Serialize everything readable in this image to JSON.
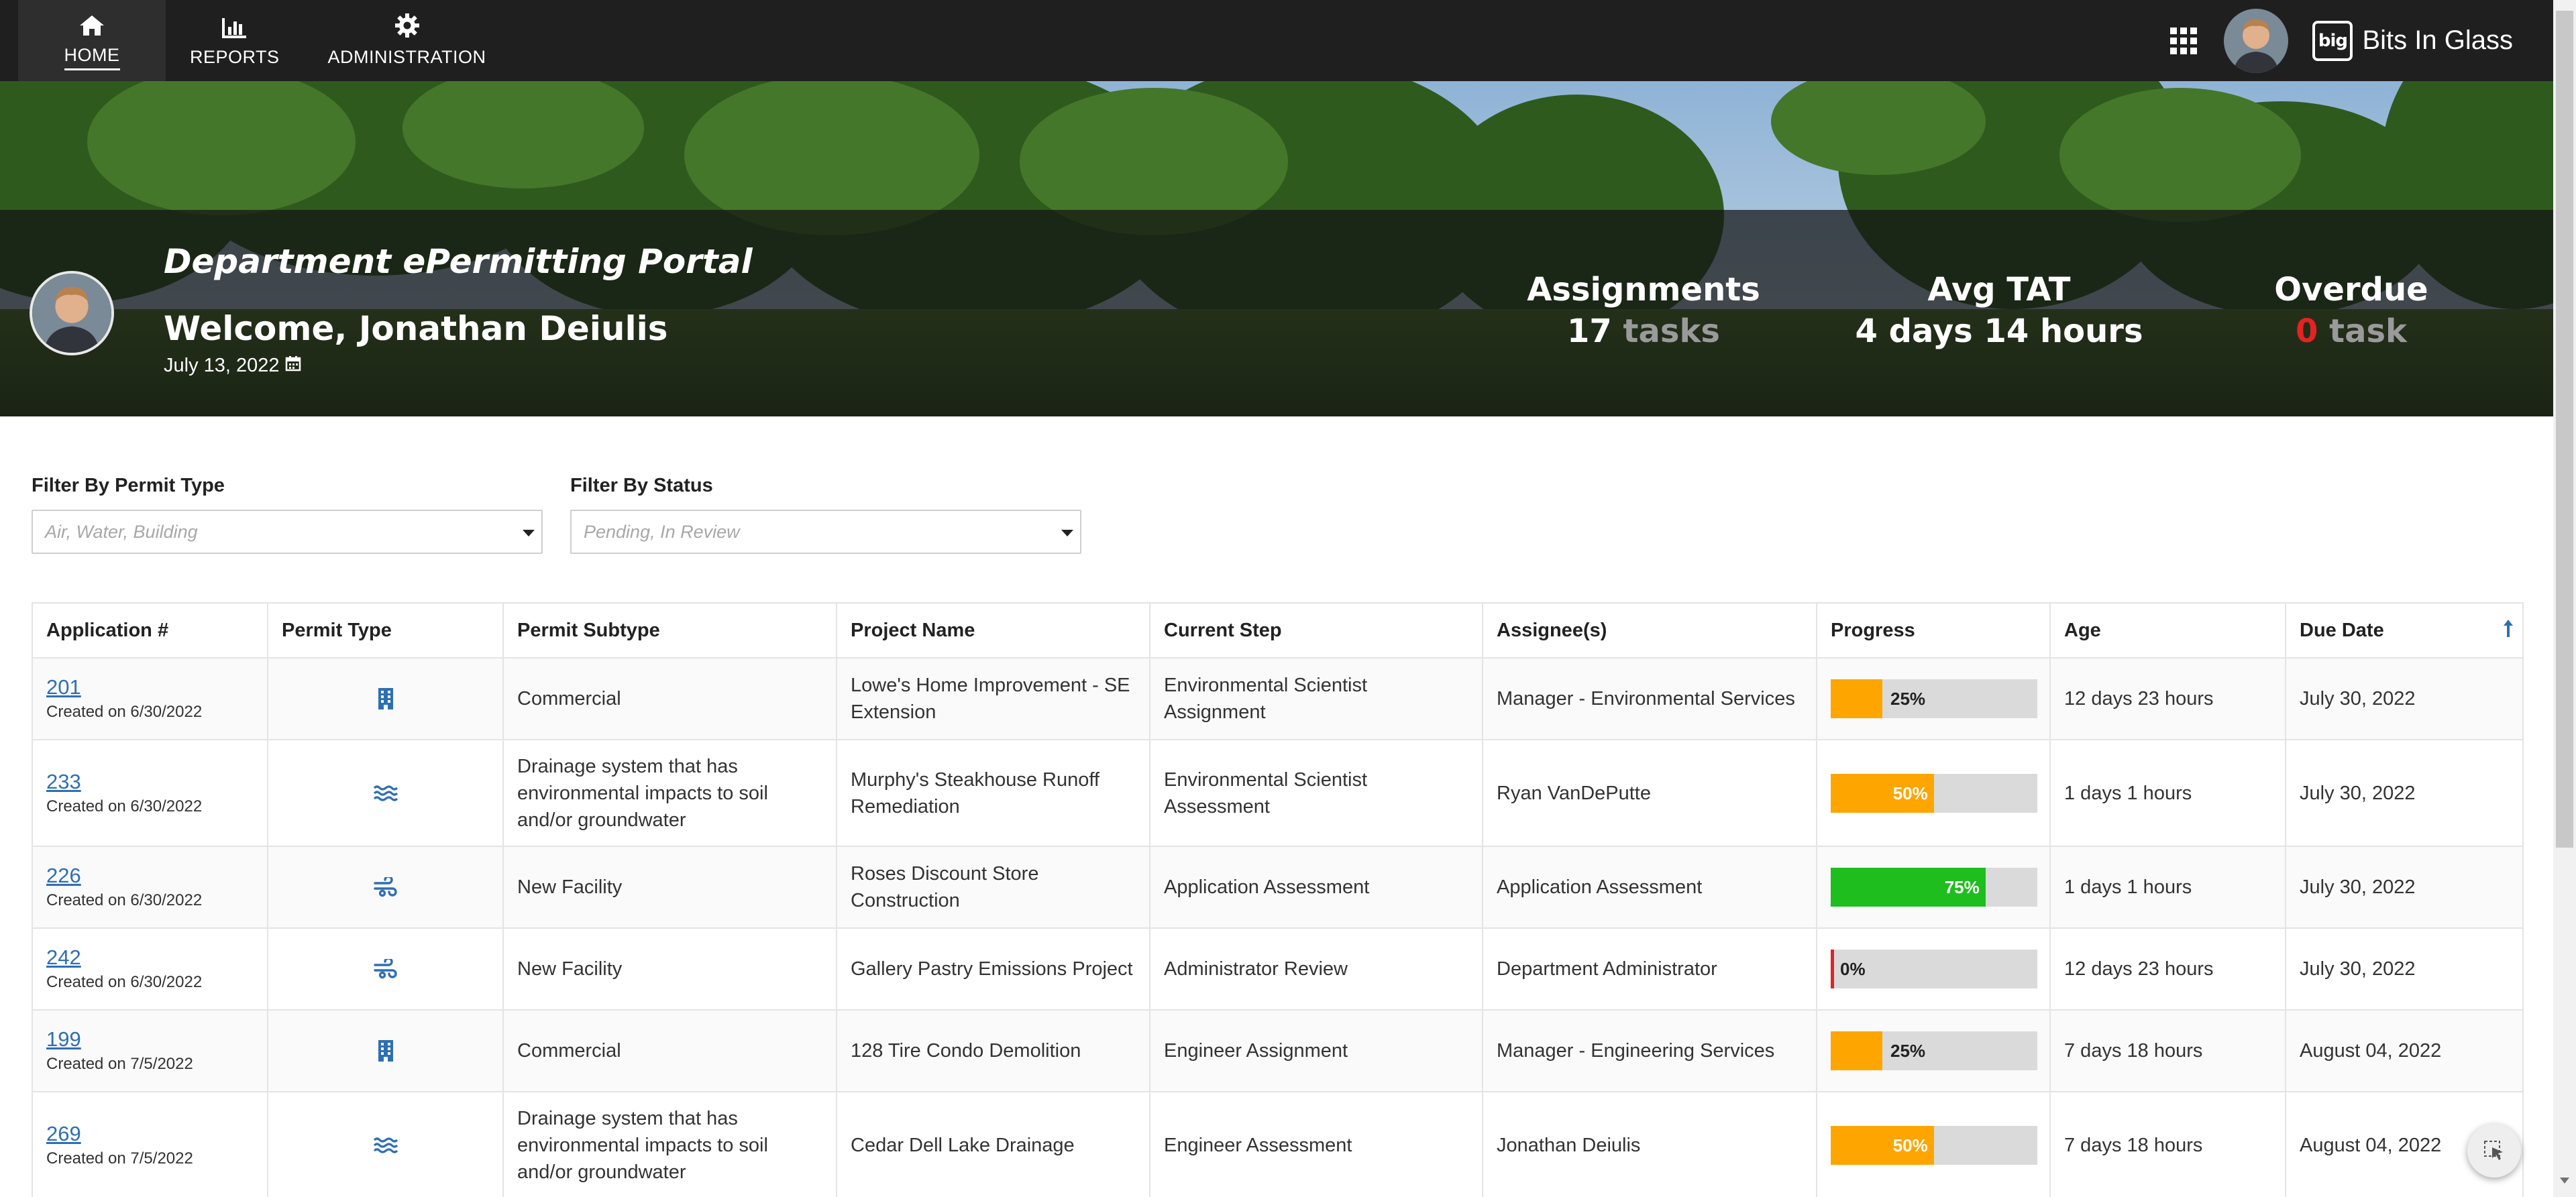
{
  "nav": {
    "items": [
      {
        "label": "HOME",
        "icon": "home-icon"
      },
      {
        "label": "REPORTS",
        "icon": "bar-chart-icon"
      },
      {
        "label": "ADMINISTRATION",
        "icon": "gear-icon"
      }
    ],
    "brand": "Bits In Glass",
    "brand_logo_text": "big"
  },
  "hero": {
    "portal_title": "Department ePermitting Portal",
    "welcome": "Welcome, Jonathan Deiulis",
    "date": "July 13, 2022",
    "stats": {
      "assignments": {
        "label": "Assignments",
        "number": "17",
        "unit": "tasks"
      },
      "avg_tat": {
        "label": "Avg TAT",
        "value": "4 days 14 hours"
      },
      "overdue": {
        "label": "Overdue",
        "number": "0",
        "unit": "task"
      }
    }
  },
  "filters": {
    "permit_type": {
      "label": "Filter By Permit Type",
      "placeholder": "Air, Water, Building"
    },
    "status": {
      "label": "Filter By Status",
      "placeholder": "Pending, In Review"
    }
  },
  "table": {
    "headers": [
      "Application #",
      "Permit Type",
      "Permit Subtype",
      "Project Name",
      "Current Step",
      "Assignee(s)",
      "Progress",
      "Age",
      "Due Date"
    ],
    "rows": [
      {
        "app": "201",
        "created": "Created on 6/30/2022",
        "type_icon": "building-icon",
        "subtype": "Commercial",
        "project": "Lowe's Home Improvement - SE Extension",
        "step": "Environmental Scientist Assignment",
        "assignee": "Manager - Environmental Services",
        "progress": 25,
        "progress_label": "25%",
        "progress_color": "#ffa500",
        "age": "12 days 23 hours",
        "due": "July 30, 2022"
      },
      {
        "app": "233",
        "created": "Created on 6/30/2022",
        "type_icon": "water-icon",
        "subtype": "Drainage system that has environmental impacts to soil and/or groundwater",
        "project": "Murphy's Steakhouse Runoff Remediation",
        "step": "Environmental Scientist Assessment",
        "assignee": "Ryan VanDePutte",
        "progress": 50,
        "progress_label": "50%",
        "progress_color": "#ffa500",
        "age": "1 days 1 hours",
        "due": "July 30, 2022"
      },
      {
        "app": "226",
        "created": "Created on 6/30/2022",
        "type_icon": "air-icon",
        "subtype": "New Facility",
        "project": "Roses Discount Store Construction",
        "step": "Application Assessment",
        "assignee": "Application Assessment",
        "progress": 75,
        "progress_label": "75%",
        "progress_color": "#1ebe1e",
        "age": "1 days 1 hours",
        "due": "July 30, 2022"
      },
      {
        "app": "242",
        "created": "Created on 6/30/2022",
        "type_icon": "air-icon",
        "subtype": "New Facility",
        "project": "Gallery Pastry Emissions Project",
        "step": "Administrator Review",
        "assignee": "Department Administrator",
        "progress": 0,
        "progress_label": "0%",
        "progress_color": "#d9262c",
        "age": "12 days 23 hours",
        "due": "July 30, 2022"
      },
      {
        "app": "199",
        "created": "Created on 7/5/2022",
        "type_icon": "building-icon",
        "subtype": "Commercial",
        "project": "128 Tire Condo Demolition",
        "step": "Engineer Assignment",
        "assignee": "Manager - Engineering Services",
        "progress": 25,
        "progress_label": "25%",
        "progress_color": "#ffa500",
        "age": "7 days 18 hours",
        "due": "August 04, 2022"
      },
      {
        "app": "269",
        "created": "Created on 7/5/2022",
        "type_icon": "water-icon",
        "subtype": "Drainage system that has environmental impacts to soil and/or groundwater",
        "project": "Cedar Dell Lake Drainage",
        "step": "Engineer Assessment",
        "assignee": "Jonathan Deiulis",
        "progress": 50,
        "progress_label": "50%",
        "progress_color": "#ffa500",
        "age": "7 days 18 hours",
        "due": "August 04, 2022"
      }
    ]
  },
  "colors": {
    "navbar": "#1f1f1f",
    "link": "#2d6fb4",
    "orange": "#ffa500",
    "green": "#1ebe1e",
    "red": "#e52222"
  }
}
